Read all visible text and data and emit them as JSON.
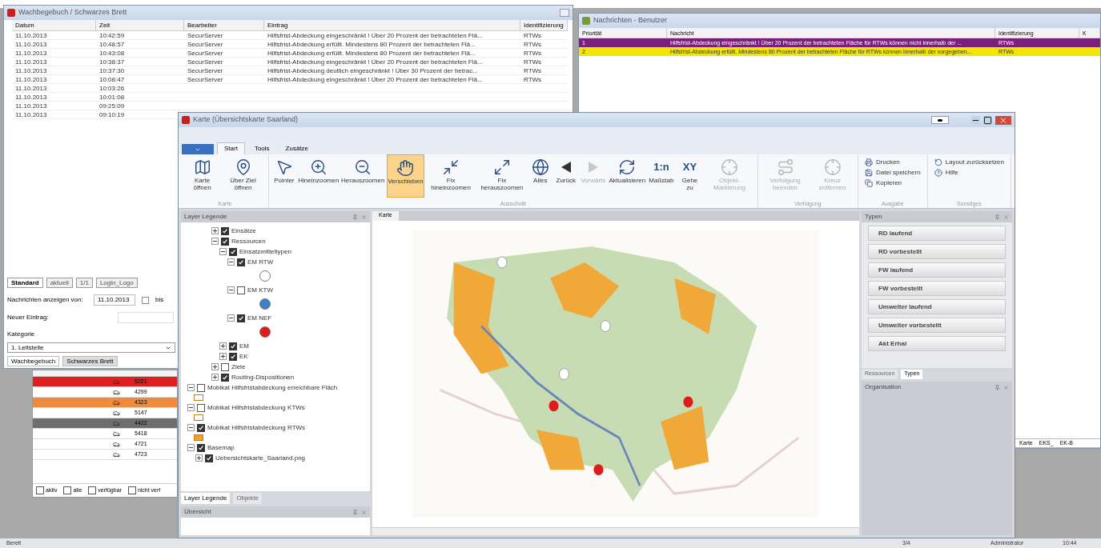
{
  "journal": {
    "title": "Wachbegebuch / Schwarzes Brett",
    "columns": [
      "Datum",
      "Zeit",
      "Bearbeiter",
      "Eintrag",
      "Identifizierung"
    ],
    "rows": [
      [
        "11.10.2013",
        "10:42:59",
        "SecurServer",
        "Hilfsfrist-Abdeckung eingeschränkt ! Über 20 Prozent der betrachteten Flä...",
        "RTWs"
      ],
      [
        "11.10.2013",
        "10:48:57",
        "SecurServer",
        "Hilfsfrist-Abdeckung erfüllt. Mindestens 80 Prozent der betrachteten Flä...",
        "RTWs"
      ],
      [
        "11.10.2013",
        "10:43:08",
        "SecurServer",
        "Hilfsfrist-Abdeckung erfüllt. Mindestens 80 Prozent der betrachteten Flä...",
        "RTWs"
      ],
      [
        "11.10.2013",
        "10:38:37",
        "SecurServer",
        "Hilfsfrist-Abdeckung eingeschränkt ! Über 20 Prozent der betrachteten Flä...",
        "RTWs"
      ],
      [
        "11.10.2013",
        "10:37:30",
        "SecurServer",
        "Hilfsfrist-Abdeckung deutlich eingeschränkt ! Über 30 Prozent der betrac...",
        "RTWs"
      ],
      [
        "11.10.2013",
        "10:08:47",
        "SecurServer",
        "Hilfsfrist-Abdeckung eingeschränkt ! Über 20 Prozent der betrachteten Flä...",
        "RTWs"
      ],
      [
        "11.10.2013",
        "10:03:26"
      ],
      [
        "11.10.2013",
        "10:01:08"
      ],
      [
        "11.10.2013",
        "09:25:09"
      ],
      [
        "11.10.2013",
        "09:10:19"
      ]
    ],
    "tabs": [
      {
        "label": "Standard",
        "selected": true
      },
      {
        "label": "aktuell",
        "selected": false
      },
      {
        "label": "1/1",
        "selected": false
      },
      {
        "label": "Login_Logo",
        "selected": false
      }
    ],
    "from_label": "Nachrichten anzeigen von:",
    "from_value": "11.10.2013",
    "to_label": "bis",
    "entry_label": "Neuer Eintrag:",
    "category_label": "Kategorie",
    "category_value": "1. Leitstelle",
    "bottom_tabs": [
      {
        "label": "Wachbegebuch",
        "selected": true
      },
      {
        "label": "Schwarzes Brett",
        "selected": false
      }
    ]
  },
  "vehicles": {
    "rows": [
      {
        "id": "5221",
        "color": "#e02020"
      },
      {
        "id": "4299",
        "color": "#ffffff"
      },
      {
        "id": "4323",
        "color": "#f08a3c"
      },
      {
        "id": "5147",
        "color": "#ffffff"
      },
      {
        "id": "4422",
        "color": "#6e6e6e"
      },
      {
        "id": "5418",
        "color": "#ffffff"
      },
      {
        "id": "4721",
        "color": "#ffffff"
      },
      {
        "id": "4723",
        "color": "#ffffff"
      }
    ],
    "filters": [
      {
        "label": "aktiv",
        "checked": false
      },
      {
        "label": "alle",
        "checked": false
      },
      {
        "label": "verfügbar",
        "checked": false
      },
      {
        "label": "nicht verf",
        "checked": false
      }
    ]
  },
  "messages": {
    "title": "Nachrichten - Benutzer",
    "columns": [
      "Priorität",
      "Nachricht",
      "Identifizierung",
      "K"
    ],
    "rows": [
      {
        "priority": "1",
        "text": "Hilfsfrist-Abdeckung eingeschränkt ! Über 20 Prozent der betrachteten Fläche für RTWs können nicht innerhalb der ...",
        "id": "RTWs",
        "color": "#7b1f7a"
      },
      {
        "priority": "2",
        "text": "Hilfsfrist-Abdeckung erfüllt. Mindestens 80 Prozent der betrachteten Fläche für RTWs können innerhalb der vorgegeben...",
        "id": "RTWs",
        "color": "#f2e600"
      }
    ],
    "back_tabs": [
      "Karte",
      "EKS_",
      "EK-B"
    ]
  },
  "map_window": {
    "title": "Karte (Übersichtskarte Saarland)",
    "ribbon_tabs": [
      {
        "label": "Start",
        "selected": true
      },
      {
        "label": "Tools",
        "selected": false
      },
      {
        "label": "Zusätze",
        "selected": false
      }
    ],
    "groups": [
      {
        "label": "Karte",
        "items": [
          {
            "label": "Karte öffnen",
            "selected": false,
            "disabled": false
          },
          {
            "label": "Über Ziel öffnen",
            "selected": false,
            "disabled": false
          }
        ]
      },
      {
        "label": "Ausschnitt",
        "items": [
          {
            "label": "Pointer",
            "selected": false,
            "disabled": false
          },
          {
            "label": "Hineinzoomen",
            "selected": false,
            "disabled": false
          },
          {
            "label": "Herauszoomen",
            "selected": false,
            "disabled": false
          },
          {
            "label": "Verschieben",
            "selected": true,
            "disabled": false
          },
          {
            "label": "Fix hineinzoomen",
            "selected": false,
            "disabled": false
          },
          {
            "label": "Fix herauszoomen",
            "selected": false,
            "disabled": false
          },
          {
            "label": "Alles",
            "selected": false,
            "disabled": false
          },
          {
            "label": "Zurück",
            "selected": false,
            "disabled": false
          },
          {
            "label": "Vorwärts",
            "selected": false,
            "disabled": true
          },
          {
            "label": "Aktualisieren",
            "selected": false,
            "disabled": false
          },
          {
            "label": "Maßstab",
            "glyph": "1:n",
            "selected": false,
            "disabled": false
          },
          {
            "label": "Gehe zu",
            "glyph": "XY",
            "selected": false,
            "disabled": false
          },
          {
            "label": "Objekt-Markierung",
            "selected": false,
            "disabled": true
          }
        ]
      },
      {
        "label": "Verfolgung",
        "items": [
          {
            "label": "Verfolgung beenden",
            "selected": false,
            "disabled": true
          },
          {
            "label": "Kreuz entfernen",
            "selected": false,
            "disabled": true
          }
        ]
      }
    ],
    "small_groups": [
      {
        "label": "Ausgabe",
        "items": [
          "Drucken",
          "Datei speichern",
          "Kopieren"
        ]
      },
      {
        "label": "Sonstiges",
        "items": [
          "Layout zurücksetzen",
          "Hilfe"
        ]
      }
    ],
    "legend": {
      "title": "Layer Legende",
      "tree": [
        {
          "label": "Einsätze",
          "checked": true,
          "expanded": false
        },
        {
          "label": "Ressourcen",
          "checked": true,
          "expanded": true,
          "children": [
            {
              "label": "Einsatzmitteltypen",
              "checked": true,
              "expanded": true,
              "children": [
                {
                  "label": "EM RTW",
                  "checked": true,
                  "expanded": true,
                  "symbol": {
                    "kind": "circle",
                    "color": "#ffffff"
                  }
                },
                {
                  "label": "EM KTW",
                  "checked": false,
                  "expanded": true,
                  "symbol": {
                    "kind": "circle",
                    "color": "#3f7fc4"
                  }
                },
                {
                  "label": "EM NEF",
                  "checked": true,
                  "expanded": true,
                  "symbol": {
                    "kind": "circle",
                    "color": "#e01b1b"
                  }
                }
              ]
            },
            {
              "label": "EM",
              "checked": true,
              "expanded": false
            },
            {
              "label": "EK",
              "checked": true,
              "expanded": false
            }
          ]
        },
        {
          "label": "Ziele",
          "checked": false,
          "expanded": false
        },
        {
          "label": "Routing-Dispositionen",
          "checked": true,
          "expanded": false
        }
      ],
      "layers": [
        {
          "label": "Mobikat Hilfsfristabdeckung erreichbare Fläch",
          "checked": false,
          "expanded": true,
          "symbol": {
            "kind": "square",
            "color": "#ffffff"
          }
        },
        {
          "label": "Mobikat Hilfsfristabdeckung KTWs",
          "checked": false,
          "expanded": true,
          "symbol": {
            "kind": "square",
            "color": "#ffffff"
          }
        },
        {
          "label": "Mobikat Hilfsfristabdeckung RTWs",
          "checked": true,
          "expanded": true,
          "symbol": {
            "kind": "square",
            "color": "#f0a030"
          }
        },
        {
          "label": "Basemap",
          "checked": true,
          "expanded": true,
          "children": [
            {
              "label": "Uebersichtskarte_Saarland.png",
              "checked": true,
              "expanded": false
            }
          ]
        }
      ],
      "tabs": [
        {
          "label": "Layer Legende",
          "selected": true
        },
        {
          "label": "Objekte",
          "selected": false
        }
      ]
    },
    "overview_title": "Übersicht",
    "map_tab": "Karte",
    "types": {
      "title": "Typen",
      "items": [
        "RD laufend",
        "RD vorbestellt",
        "FW laufend",
        "FW vorbestellt",
        "Umwelter laufend",
        "Umwelter vorbestellt",
        "Akt Erhal"
      ],
      "tabs": [
        {
          "label": "Ressourcen",
          "selected": false
        },
        {
          "label": "Typen",
          "selected": true
        }
      ]
    },
    "organisation_title": "Organisation"
  },
  "status_bar": [
    "Bereit",
    "3/4",
    "Administrator",
    "10:44"
  ]
}
